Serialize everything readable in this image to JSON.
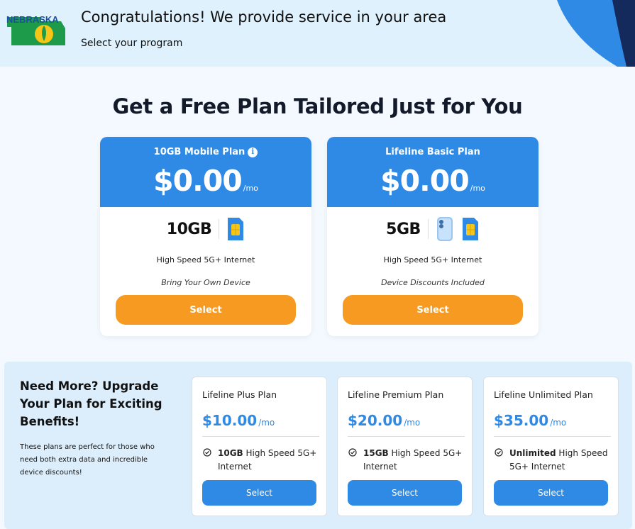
{
  "header": {
    "logo_text": "NEBRASKA",
    "title": "Congratulations! We provide service in your area",
    "subtitle": "Select your program"
  },
  "main_title": "Get a Free Plan Tailored Just for You",
  "plans": [
    {
      "name": "10GB Mobile Plan",
      "has_info": true,
      "price": "$0.00",
      "per": "/mo",
      "data": "10GB",
      "icons": [
        "sim-icon"
      ],
      "feature": "High Speed 5G+ Internet",
      "note": "Bring Your Own Device",
      "select_label": "Select"
    },
    {
      "name": "Lifeline Basic Plan",
      "has_info": false,
      "price": "$0.00",
      "per": "/mo",
      "data": "5GB",
      "icons": [
        "phone-icon",
        "sim-icon"
      ],
      "feature": "High Speed 5G+ Internet",
      "note": "Device Discounts Included",
      "select_label": "Select"
    }
  ],
  "upgrade": {
    "title": "Need More? Upgrade Your Plan for Exciting Benefits!",
    "description": "These plans are perfect for those who need both extra data and incredible device discounts!",
    "cards": [
      {
        "name": "Lifeline Plus Plan",
        "price": "$10.00",
        "per": "/mo",
        "feature_bold": "10GB",
        "feature_rest": " High Speed 5G+ Internet",
        "select_label": "Select"
      },
      {
        "name": "Lifeline Premium Plan",
        "price": "$20.00",
        "per": "/mo",
        "feature_bold": "15GB",
        "feature_rest": " High Speed 5G+ Internet",
        "select_label": "Select"
      },
      {
        "name": "Lifeline Unlimited Plan",
        "price": "$35.00",
        "per": "/mo",
        "feature_bold": "Unlimited",
        "feature_rest": " High Speed 5G+ Internet",
        "select_label": "Select"
      }
    ]
  },
  "colors": {
    "primary_blue": "#2e8ae5",
    "orange": "#f79a22",
    "header_bg": "#def1fd",
    "upgrade_bg": "#dceefc"
  }
}
